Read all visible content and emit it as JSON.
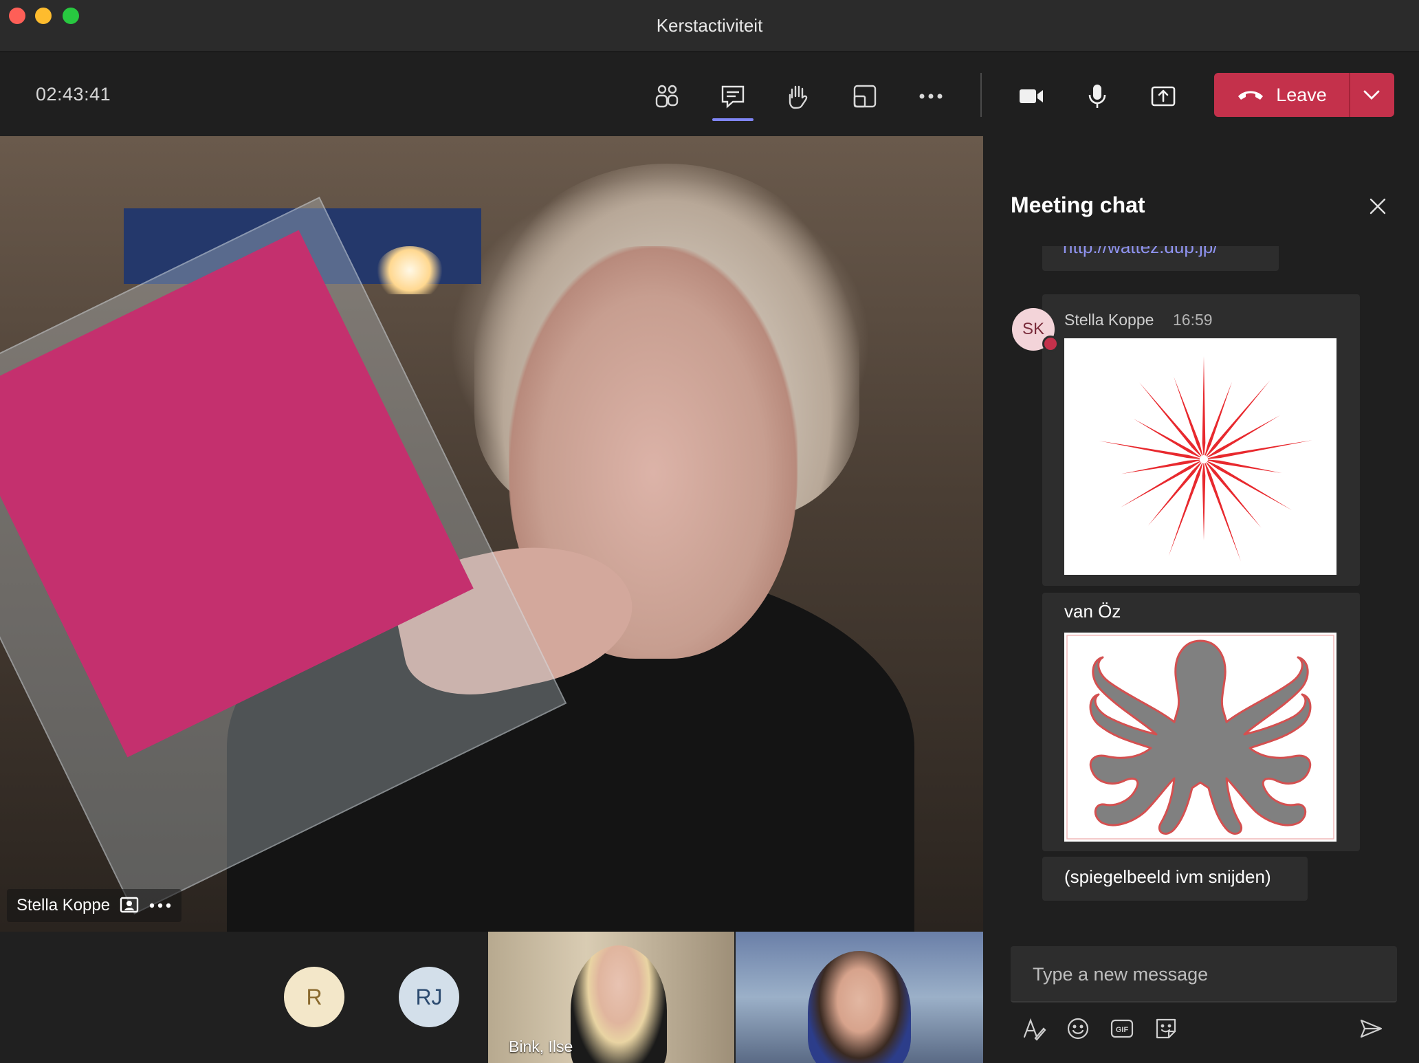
{
  "window": {
    "title": "Kerstactiviteit"
  },
  "toolbar": {
    "timer": "02:43:41",
    "leave_label": "Leave"
  },
  "stage": {
    "main_participant": "Stella Koppe"
  },
  "participants": {
    "avatars": [
      "R",
      "RJ"
    ],
    "video_tiles": [
      {
        "name": "Bink, Ilse"
      },
      {
        "name": ""
      }
    ]
  },
  "chat": {
    "title": "Meeting chat",
    "previous_link": "http://wattez.dup.jp/",
    "message": {
      "sender_initials": "SK",
      "sender_name": "Stella Koppe",
      "time": "16:59",
      "text_1": "van Öz",
      "text_2": "(spiegelbeeld ivm snijden)"
    },
    "composer_placeholder": "Type a new message"
  },
  "colors": {
    "leave_red": "#c4314b",
    "accent": "#7f85f5",
    "starburst": "#e8292e",
    "octopus": "#808080"
  },
  "icons": [
    "people-icon",
    "chat-icon",
    "raise-hand-icon",
    "layout-icon",
    "more-icon",
    "camera-icon",
    "microphone-icon",
    "share-icon",
    "hangup-icon",
    "chevron-down-icon",
    "close-icon",
    "format-icon",
    "emoji-icon",
    "gif-icon",
    "sticker-icon",
    "send-icon",
    "spotlight-icon"
  ]
}
